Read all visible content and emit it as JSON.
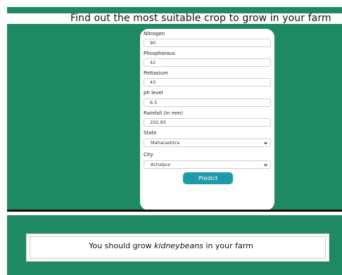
{
  "header": {
    "title": "Find out the most suitable crop to grow in your farm"
  },
  "form": {
    "nitrogen": {
      "label": "Nitrogen",
      "value": "90"
    },
    "phosphorous": {
      "label": "Phosphorous",
      "value": "42"
    },
    "pottasium": {
      "label": "Pottasium",
      "value": "43"
    },
    "ph": {
      "label": "ph level",
      "value": "6.5"
    },
    "rainfall": {
      "label": "Rainfall (in mm)",
      "value": "202.93"
    },
    "state": {
      "label": "State",
      "value": "Maharashtra"
    },
    "city": {
      "label": "City",
      "value": "Achalpur"
    },
    "predict_label": "Predict"
  },
  "result": {
    "prefix": "You should grow ",
    "crop": "kidneybeans",
    "suffix": " in your farm"
  },
  "colors": {
    "primary_green": "#1f8a62",
    "button_teal": "#1c9aa9"
  }
}
